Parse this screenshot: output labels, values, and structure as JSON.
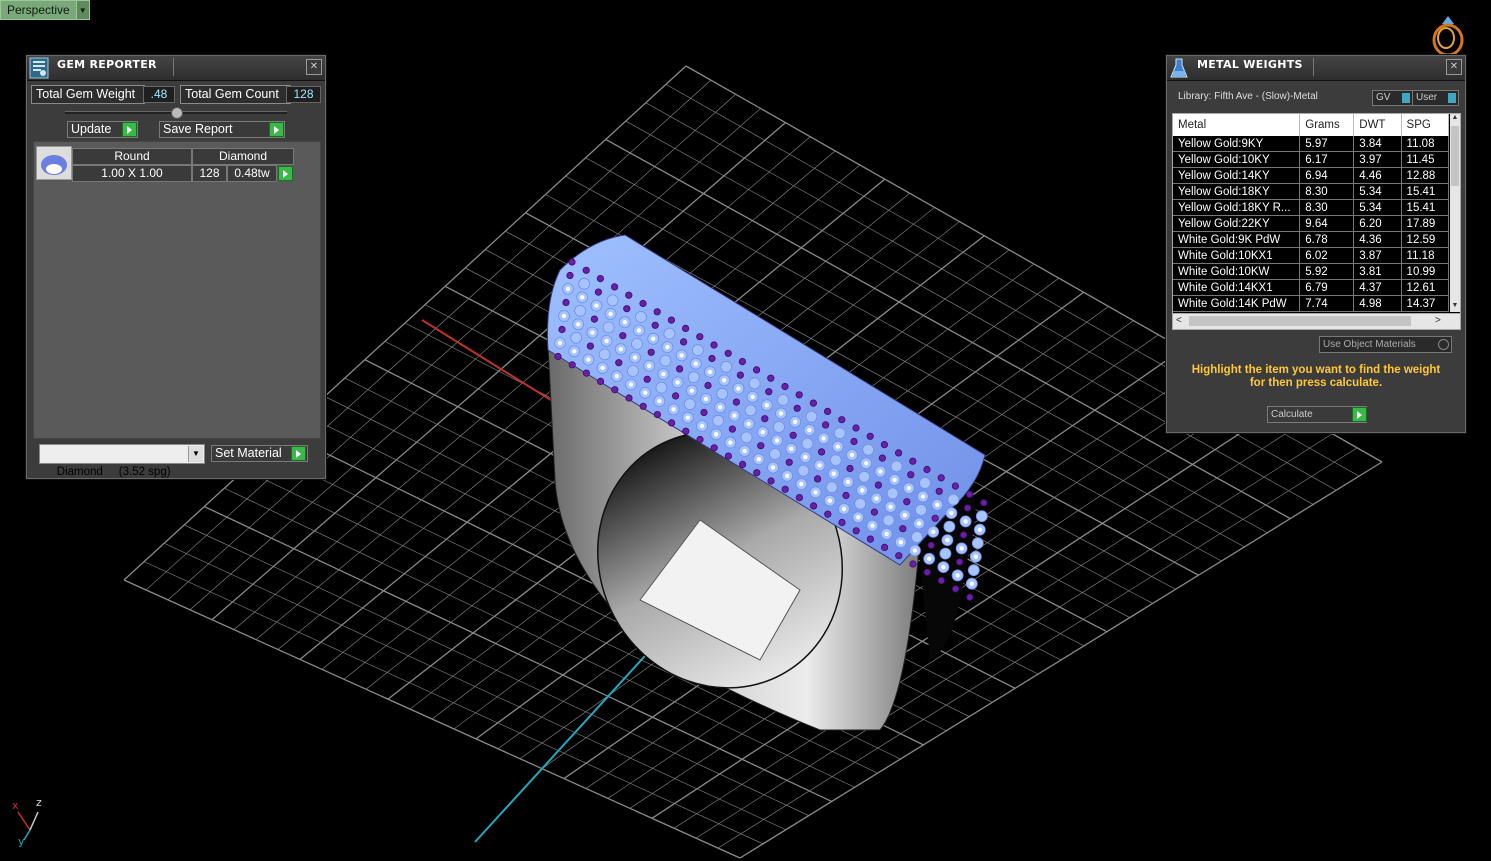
{
  "viewport": {
    "view_label": "Perspective",
    "axis_labels": {
      "x": "x",
      "y": "y",
      "z": "z"
    }
  },
  "gem_reporter": {
    "title": "GEM REPORTER",
    "total_gem_weight_label": "Total Gem Weight",
    "total_gem_weight_value": ".48",
    "total_gem_count_label": "Total Gem Count",
    "total_gem_count_value": "128",
    "update_label": "Update",
    "save_report_label": "Save Report",
    "gem_row": {
      "shape": "Round",
      "material": "Diamond",
      "size": "1.00 X 1.00",
      "count": "128",
      "weight": "0.48tw"
    },
    "material_select": "Diamond     (3.52 spg)",
    "set_material_label": "Set Material",
    "close_symbol": "✕"
  },
  "metal_weights": {
    "title": "METAL WEIGHTS",
    "library": "Library: Fifth Ave - (Slow)-Metal",
    "toggle_gv": "GV",
    "toggle_user": "User",
    "columns": [
      "Metal",
      "Grams",
      "DWT",
      "SPG"
    ],
    "rows": [
      [
        "Yellow Gold:9KY",
        "5.97",
        "3.84",
        "11.08"
      ],
      [
        "Yellow Gold:10KY",
        "6.17",
        "3.97",
        "11.45"
      ],
      [
        "Yellow Gold:14KY",
        "6.94",
        "4.46",
        "12.88"
      ],
      [
        "Yellow Gold:18KY",
        "8.30",
        "5.34",
        "15.41"
      ],
      [
        "Yellow Gold:18KY R...",
        "8.30",
        "5.34",
        "15.41"
      ],
      [
        "Yellow Gold:22KY",
        "9.64",
        "6.20",
        "17.89"
      ],
      [
        "White Gold:9K PdW",
        "6.78",
        "4.36",
        "12.59"
      ],
      [
        "White Gold:10KX1",
        "6.02",
        "3.87",
        "11.18"
      ],
      [
        "White Gold:10KW",
        "5.92",
        "3.81",
        "10.99"
      ],
      [
        "White Gold:14KX1",
        "6.79",
        "4.37",
        "12.61"
      ],
      [
        "White Gold:14K PdW",
        "7.74",
        "4.98",
        "14.37"
      ]
    ],
    "use_object_materials_label": "Use Object Materials",
    "hint": "Highlight the item you want to find the weight for then press calculate.",
    "calculate_label": "Calculate",
    "close_symbol": "✕"
  }
}
